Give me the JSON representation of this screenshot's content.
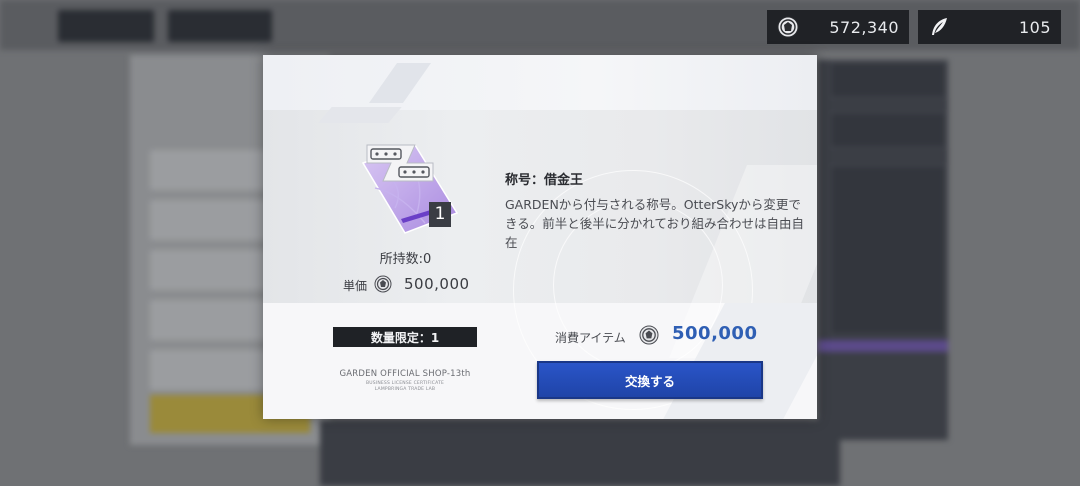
{
  "currency": {
    "coin_value": "572,340",
    "coin_icon": "medal-coin-icon",
    "feather_value": "105",
    "feather_icon": "feather-icon"
  },
  "item": {
    "icon": "title-plate-icon",
    "count_badge": "1",
    "owned_text": "所持数:0",
    "unit_price_label": "単価",
    "unit_price_value": "500,000",
    "title": "称号：借金王",
    "description": "GARDENから付与される称号。OtterSkyから変更できる。前半と後半に分かれており組み合わせは自由自在"
  },
  "limit": {
    "label": "数量限定：1"
  },
  "shop": {
    "name": "GARDEN OFFICIAL SHOP-13th",
    "line1": "BUSINESS LICENSE CERTIFICATE",
    "line2": "LAMPBRINGA TRADE LAB"
  },
  "cost": {
    "label": "消費アイテム",
    "value": "500,000"
  },
  "buttons": {
    "exchange_label": "交換する"
  },
  "colors": {
    "accent_blue": "#2a55c8",
    "cost_blue": "#2f5fb4",
    "dark": "#1f2226",
    "item_purple": "#b79be6"
  }
}
